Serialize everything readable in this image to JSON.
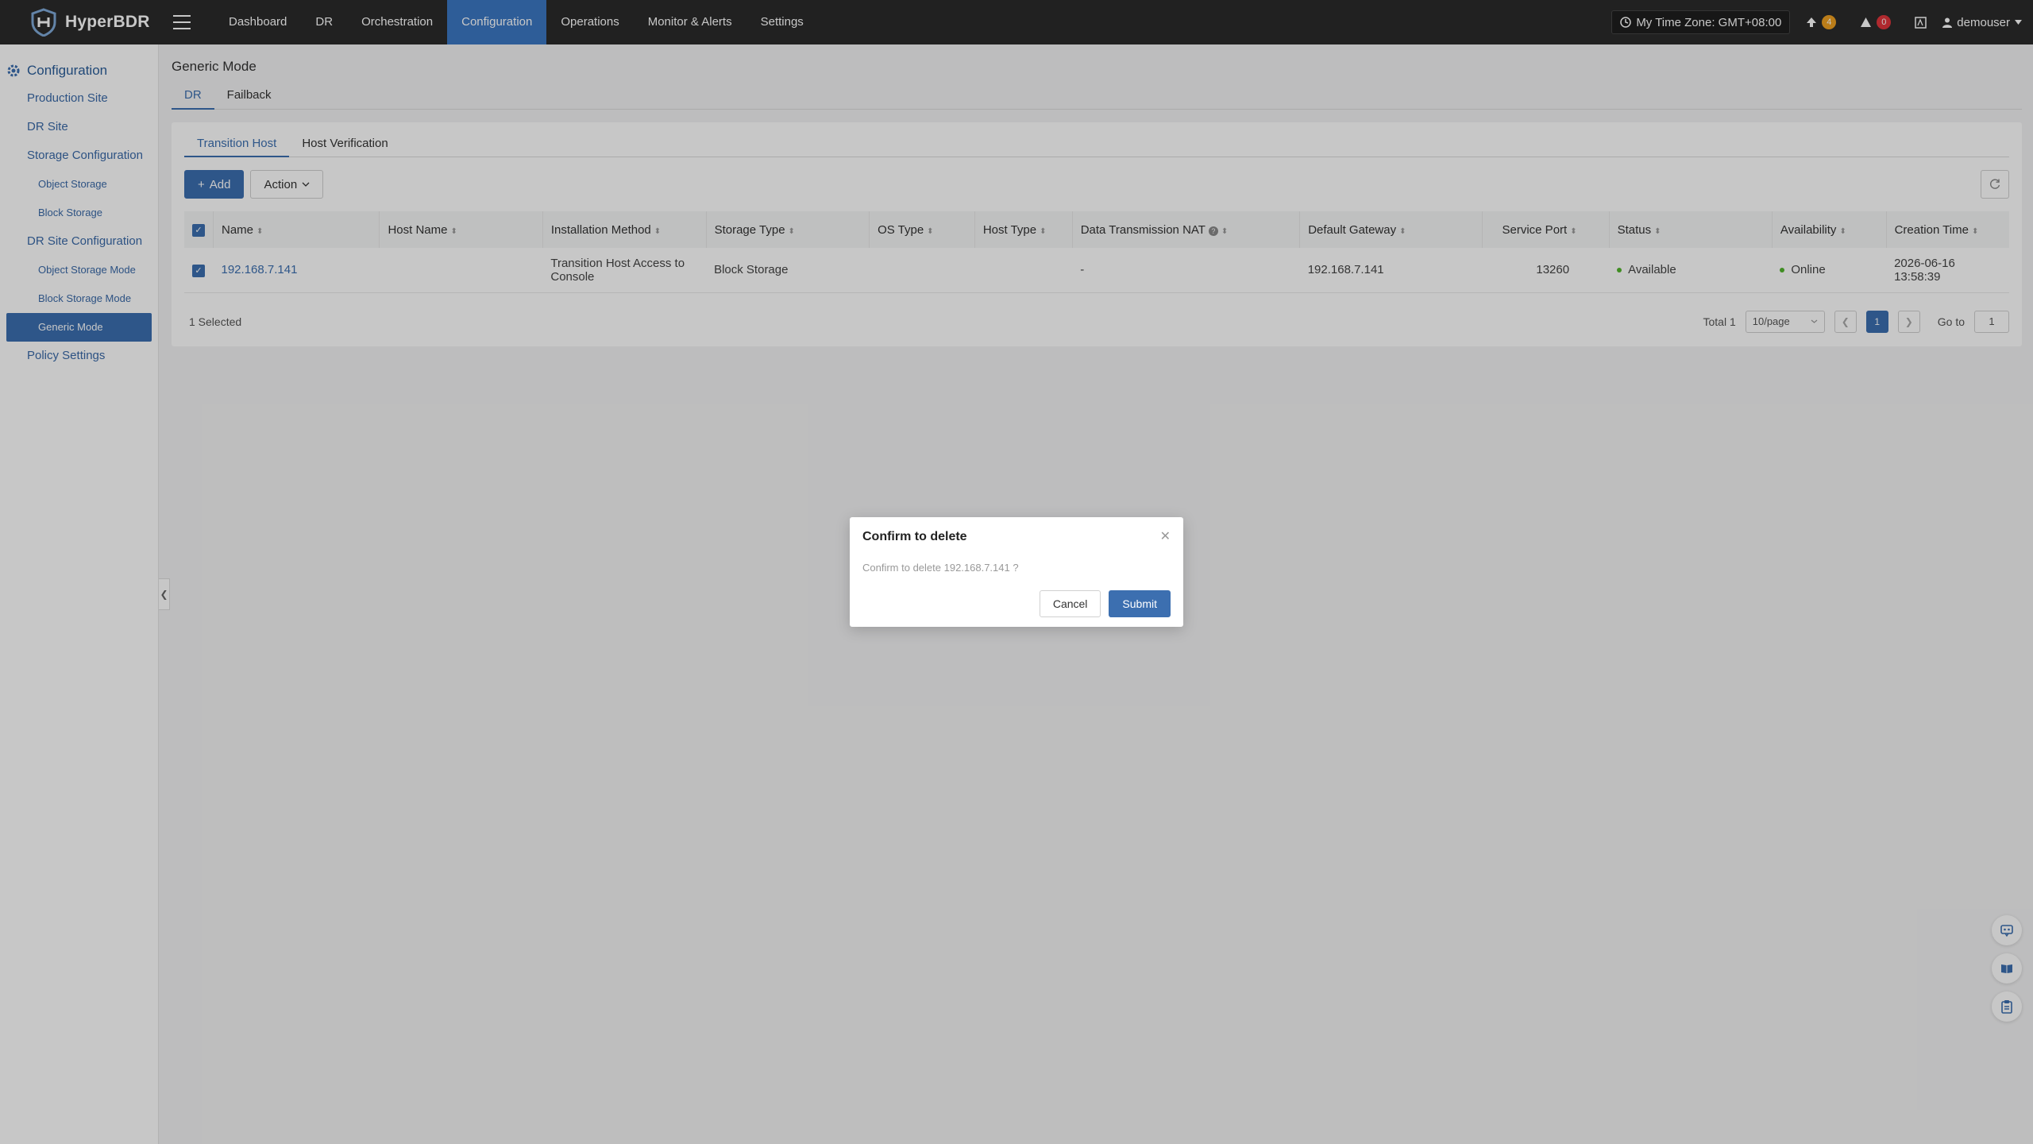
{
  "app": {
    "name": "HyperBDR"
  },
  "nav": [
    {
      "label": "Dashboard"
    },
    {
      "label": "DR"
    },
    {
      "label": "Orchestration"
    },
    {
      "label": "Configuration"
    },
    {
      "label": "Operations"
    },
    {
      "label": "Monitor & Alerts"
    },
    {
      "label": "Settings"
    }
  ],
  "header": {
    "timezone": "My Time Zone: GMT+08:00",
    "upgrade_count": "4",
    "alert_count": "0",
    "user": "demouser"
  },
  "sidebar": {
    "title": "Configuration",
    "items": [
      {
        "label": "Production Site"
      },
      {
        "label": "DR Site"
      },
      {
        "label": "Storage Configuration"
      },
      {
        "label": "Object Storage"
      },
      {
        "label": "Block Storage"
      },
      {
        "label": "DR Site Configuration"
      },
      {
        "label": "Object Storage Mode"
      },
      {
        "label": "Block Storage Mode"
      },
      {
        "label": "Generic Mode"
      },
      {
        "label": "Policy Settings"
      }
    ]
  },
  "page": {
    "title": "Generic Mode",
    "tabs": [
      {
        "label": "DR"
      },
      {
        "label": "Failback"
      }
    ],
    "inner_tabs": [
      {
        "label": "Transition Host"
      },
      {
        "label": "Host Verification"
      }
    ],
    "add_label": "Add",
    "action_label": "Action"
  },
  "table": {
    "columns": [
      "Name",
      "Host Name",
      "Installation Method",
      "Storage Type",
      "OS Type",
      "Host Type",
      "Data Transmission NAT",
      "Default Gateway",
      "Service Port",
      "Status",
      "Availability",
      "Creation Time"
    ],
    "rows": [
      {
        "name": "192.168.7.141",
        "host_name": "",
        "install_line1": "Transition Host Access to",
        "install_line2": "Console",
        "storage_type": "Block Storage",
        "os_type": "",
        "host_type": "",
        "nat": "-",
        "gateway": "192.168.7.141",
        "port": "13260",
        "status": "Available",
        "availability": "Online",
        "created_date": "2026-06-16",
        "created_time": "13:58:39"
      }
    ],
    "selected_text": "1 Selected",
    "total_text": "Total 1",
    "page_size": "10/page",
    "current_page": "1",
    "goto_label": "Go to",
    "goto_value": "1"
  },
  "modal": {
    "title": "Confirm to delete",
    "message": "Confirm to delete 192.168.7.141 ?",
    "cancel": "Cancel",
    "submit": "Submit"
  },
  "colors": {
    "accent": "#3c6fb0",
    "topbar": "#2b2b2b",
    "success": "#52b52e"
  }
}
